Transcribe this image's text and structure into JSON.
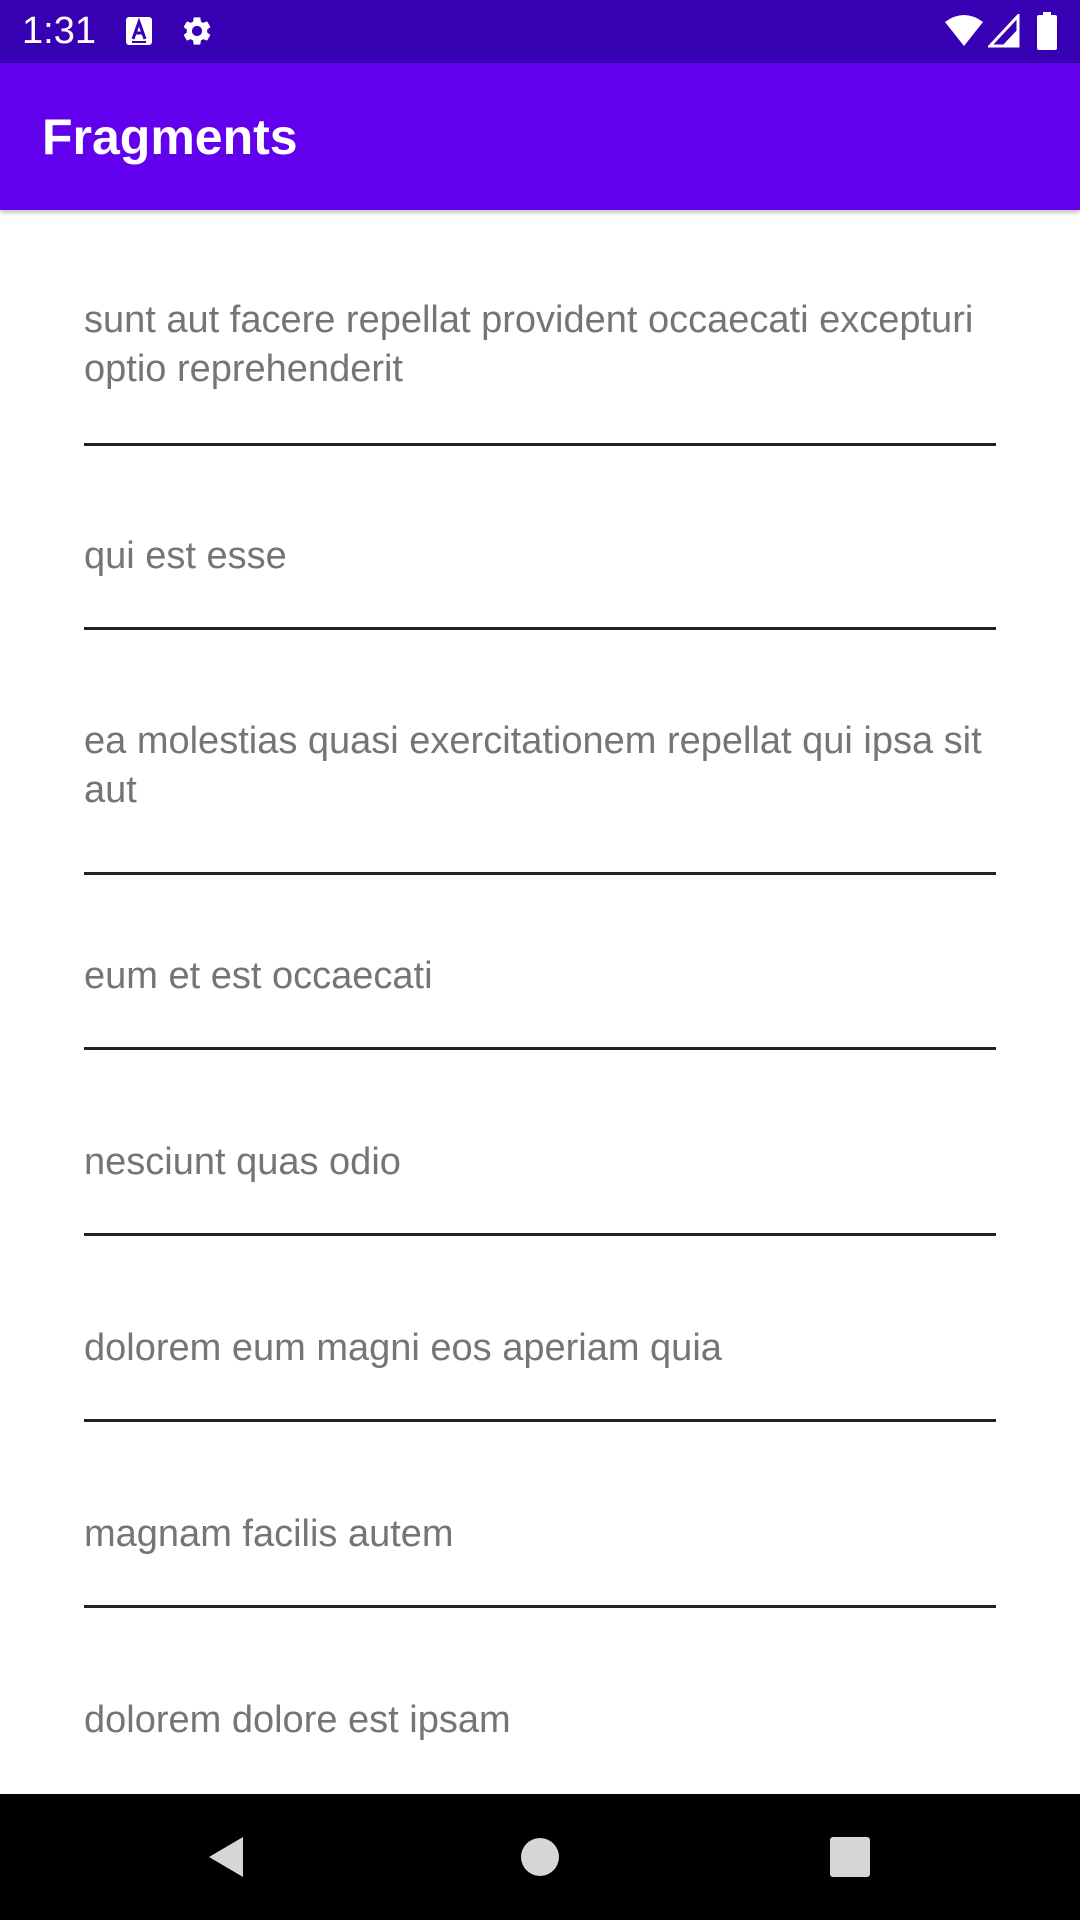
{
  "status_bar": {
    "time": "1:31",
    "icons": [
      "a-notification-icon",
      "gear-icon",
      "wifi-icon",
      "signal-icon",
      "battery-icon"
    ],
    "color": "#3700b3"
  },
  "app_bar": {
    "title": "Fragments",
    "color": "#6200ee"
  },
  "list": {
    "items": [
      {
        "title": "sunt aut facere repellat provident occaecati excepturi optio reprehenderit"
      },
      {
        "title": "qui est esse"
      },
      {
        "title": "ea molestias quasi exercitationem repellat qui ipsa sit aut"
      },
      {
        "title": "eum et est occaecati"
      },
      {
        "title": "nesciunt quas odio"
      },
      {
        "title": "dolorem eum magni eos aperiam quia"
      },
      {
        "title": "magnam facilis autem"
      },
      {
        "title": "dolorem dolore est ipsam"
      }
    ],
    "text_color": "#757575",
    "divider_color": "#222222"
  },
  "nav_bar": {
    "buttons": [
      "back-icon",
      "home-icon",
      "recents-icon"
    ]
  }
}
